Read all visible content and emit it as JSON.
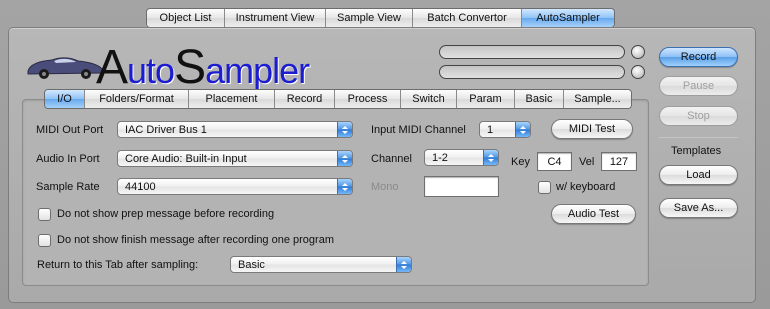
{
  "top_tabs": [
    {
      "label": "Object List",
      "selected": false
    },
    {
      "label": "Instrument View",
      "selected": false
    },
    {
      "label": "Sample View",
      "selected": false
    },
    {
      "label": "Batch Convertor",
      "selected": false
    },
    {
      "label": "AutoSampler",
      "selected": true
    }
  ],
  "logo": {
    "icon": "car-icon",
    "part1": "A",
    "part2": "uto",
    "part3": "S",
    "part4": "ampler"
  },
  "buttons": {
    "record": "Record",
    "pause": "Pause",
    "stop": "Stop",
    "templates_label": "Templates",
    "load": "Load",
    "save_as": "Save As..."
  },
  "inner_tabs": [
    {
      "label": "I/O",
      "selected": true
    },
    {
      "label": "Folders/Format",
      "selected": false
    },
    {
      "label": "Placement",
      "selected": false
    },
    {
      "label": "Record",
      "selected": false
    },
    {
      "label": "Process",
      "selected": false
    },
    {
      "label": "Switch",
      "selected": false
    },
    {
      "label": "Param",
      "selected": false
    },
    {
      "label": "Basic",
      "selected": false
    },
    {
      "label": "Sample...",
      "selected": false
    }
  ],
  "io": {
    "midi_out_port_label": "MIDI Out Port",
    "midi_out_port_value": "IAC Driver Bus 1",
    "audio_in_port_label": "Audio In Port",
    "audio_in_port_value": "Core Audio: Built-in Input",
    "sample_rate_label": "Sample Rate",
    "sample_rate_value": "44100",
    "input_midi_channel_label": "Input MIDI Channel",
    "input_midi_channel_value": "1",
    "midi_test": "MIDI Test",
    "channel_label": "Channel",
    "channel_value": "1-2",
    "key_label": "Key",
    "key_value": "C4",
    "vel_label": "Vel",
    "vel_value": "127",
    "mono_label": "Mono",
    "mono_value": "",
    "with_keyboard": "w/ keyboard",
    "audio_test": "Audio Test",
    "no_prep_msg": "Do not show prep message before recording",
    "no_finish_msg": "Do not show finish message after recording one program",
    "return_tab_label": "Return to this Tab after sampling:",
    "return_tab_value": "Basic"
  },
  "colors": {
    "accent": "#5a9fe8",
    "logo_blue": "#1c1cd0"
  }
}
